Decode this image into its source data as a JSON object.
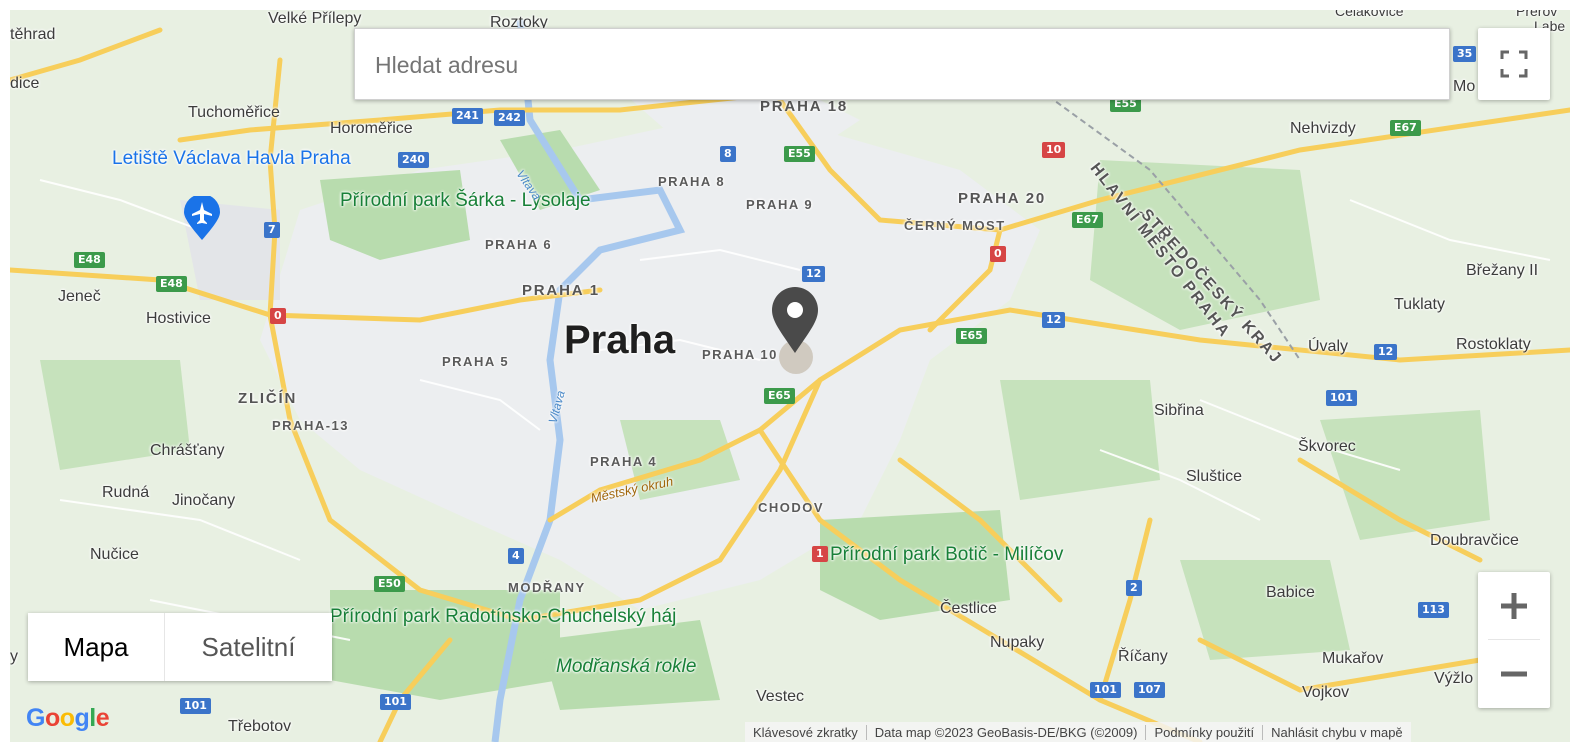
{
  "search": {
    "placeholder": "Hledat adresu"
  },
  "map_type": {
    "active": "Mapa",
    "inactive": "Satelitní"
  },
  "logo": "Google",
  "attribution": {
    "shortcuts": "Klávesové zkratky",
    "data": "Data map ©2023 GeoBasis-DE/BKG (©2009)",
    "terms": "Podmínky použití",
    "report": "Nahlásit chybu v mapě"
  },
  "icons": {
    "fullscreen": "fullscreen-icon",
    "zoom_in": "plus-icon",
    "zoom_out": "minus-icon",
    "marker": "map-pin-icon",
    "airport": "airplane-icon"
  },
  "colors": {
    "land": "#e8f0e2",
    "park": "#b8dcae",
    "urban": "#eceef0",
    "highway": "#f7ce5b",
    "water": "#a7c8ee",
    "marker": "#4a4a4a"
  },
  "map_labels": {
    "city": "Praha",
    "airport": "Letiště Václava Havla Praha",
    "parks": {
      "sarka": "Přírodní park Šárka - Lysolaje",
      "botic": "Přírodní park Botič - Milíčov",
      "radotin": "Přírodní park Radotínsko-Chuchelský háj",
      "modranska": "Modřanská rokle"
    },
    "districts": {
      "p1": "PRAHA 1",
      "p4": "PRAHA 4",
      "p5": "PRAHA 5",
      "p6": "PRAHA 6",
      "p8": "PRAHA 8",
      "p9": "PRAHA 9",
      "p10": "PRAHA 10",
      "p13": "PRAHA-13",
      "p18": "PRAHA 18",
      "p20": "PRAHA 20",
      "cerny_most": "ČERNÝ MOST",
      "chodov": "CHODOV",
      "modrany": "MODŘANY",
      "zlicin": "ZLIČÍN"
    },
    "regions": {
      "stredocesky": "STŘEDOČESKÝ KRAJ",
      "hlavni_mesto": "HLAVNÍ MĚSTO PRAHA"
    },
    "rivers": {
      "vltava_north": "Vltava",
      "vltava_south": "Vltava"
    },
    "ring": "Městský okruh",
    "towns": {
      "velke_prilepy": "Velké Přílepy",
      "roztoky": "Roztoky",
      "tehrad": "těhrad",
      "dice": "dice",
      "tuchomerice": "Tuchoměřice",
      "horomerice": "Horoměřice",
      "jenec": "Jeneč",
      "hostivice": "Hostivice",
      "chrastany": "Chrášťany",
      "rudna": "Rudná",
      "jinocany": "Jinočany",
      "nucice": "Nučice",
      "y": "y",
      "trebotov": "Třebotov",
      "vestec": "Vestec",
      "cestlice": "Čestlice",
      "nupaky": "Nupaky",
      "ricany": "Říčany",
      "sluštice": "Sluštice",
      "sibrina": "Sibřina",
      "skvorec": "Škvorec",
      "uvaly": "Úvaly",
      "tuklaty": "Tuklaty",
      "brezany": "Břežany II",
      "rostoklaty": "Rostoklaty",
      "nehvizdy": "Nehvizdy",
      "celakovice": "Čelákovice",
      "mo": "Mo",
      "dobravcice": "Doubravčice",
      "babice": "Babice",
      "mukarov": "Mukařov",
      "vojkov": "Vojkov",
      "vyzlo": "Výžlo",
      "prerov": "Přerov",
      "labe": "Labe"
    },
    "shields": {
      "s241": "241",
      "s242": "242",
      "s240": "240",
      "s7": "7",
      "e48a": "E48",
      "e48b": "E48",
      "s0a": "0",
      "s0b": "0",
      "s8": "8",
      "e55": "E55",
      "e55b": "E55",
      "s10": "10",
      "e67a": "E67",
      "e67b": "E67",
      "s12a": "12",
      "s12b": "12",
      "s12c": "12",
      "e65a": "E65",
      "e65b": "E65",
      "s101a": "101",
      "s101b": "101",
      "s101c": "101",
      "s101d": "101",
      "s107": "107",
      "s113": "113",
      "s1": "1",
      "s2": "2",
      "s4": "4",
      "e50": "E50",
      "s35": "35",
      "s101e": "101"
    }
  }
}
